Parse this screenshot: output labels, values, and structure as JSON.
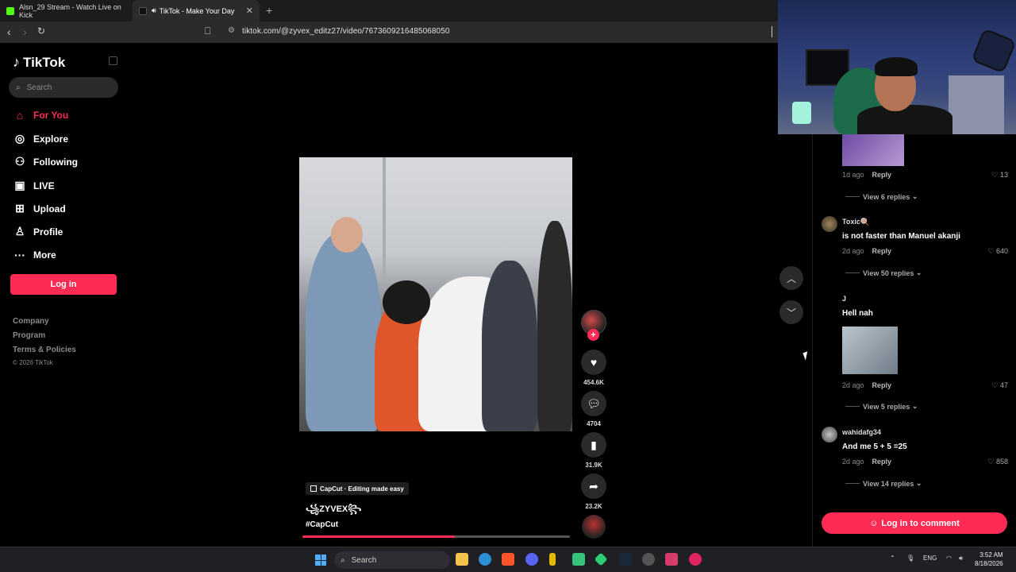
{
  "browser": {
    "tabs": [
      {
        "title": "Alsn_29 Stream - Watch Live on Kick"
      },
      {
        "title": "TikTok - Make Your Day"
      }
    ],
    "url": "tiktok.com/@zyvex_editz27/video/7673609216485068050"
  },
  "sidebar": {
    "logo": "TikTok",
    "search_placeholder": "Search",
    "nav": [
      {
        "label": "For You",
        "icon": "home-icon",
        "active": true
      },
      {
        "label": "Explore",
        "icon": "compass-icon"
      },
      {
        "label": "Following",
        "icon": "following-icon"
      },
      {
        "label": "LIVE",
        "icon": "live-icon"
      },
      {
        "label": "Upload",
        "icon": "upload-icon"
      },
      {
        "label": "Profile",
        "icon": "profile-icon"
      },
      {
        "label": "More",
        "icon": "more-icon"
      }
    ],
    "login_label": "Log in",
    "footer": [
      "Company",
      "Program",
      "Terms & Policies"
    ],
    "copyright": "© 2026 TikTok"
  },
  "video": {
    "capcut_badge": "CapCut · Editing made easy",
    "author": "꧁ZYVEX꧂",
    "hashtag": "#CapCut",
    "progress": 0.57,
    "likes": "454.6K",
    "comments": "4704",
    "saves": "31.9K",
    "shares": "23.2K"
  },
  "comments": {
    "items": [
      {
        "time": "1d ago",
        "reply": "Reply",
        "likes": "13",
        "view_replies": "View 6 replies"
      },
      {
        "user": "Toxic🍭",
        "text": "is not faster than Manuel akanji",
        "time": "2d ago",
        "reply": "Reply",
        "likes": "640",
        "view_replies": "View 50 replies"
      },
      {
        "user": "J",
        "text": "Hell nah",
        "time": "2d ago",
        "reply": "Reply",
        "likes": "47",
        "view_replies": "View 5 replies"
      },
      {
        "user": "wahidafg34",
        "text": "And me 5 + 5 =25",
        "time": "2d ago",
        "reply": "Reply",
        "likes": "858",
        "view_replies": "View 14 replies"
      }
    ],
    "login_label": "Log in to comment"
  },
  "taskbar": {
    "search_label": "Search",
    "lang": "ENG",
    "time": "3:52 AM",
    "date": "8/18/2026"
  },
  "colors": {
    "accent": "#fe2c55",
    "background": "#000000"
  }
}
